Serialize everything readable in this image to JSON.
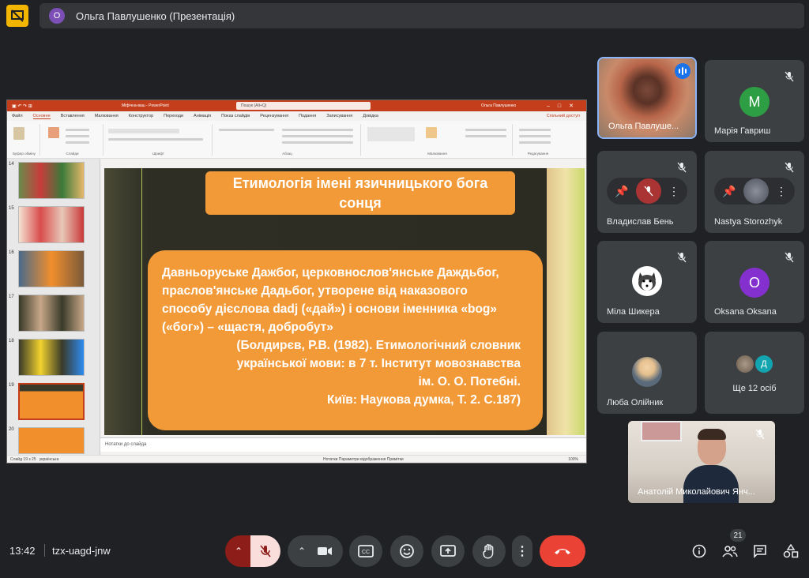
{
  "presenter": {
    "initial": "О",
    "label": "Ольга Павлушенко (Презентація)"
  },
  "powerpoint": {
    "document_title": "Міфічна-ваш - PowerPoint",
    "search_placeholder": "Пошук (Alt+Q)",
    "user": "Ольга Павлушенко",
    "window_controls": "–□✕",
    "menu": [
      "Файл",
      "Основне",
      "Вставлення",
      "Малювання",
      "Конструктор",
      "Переходи",
      "Анімація",
      "Показ слайдів",
      "Рецензування",
      "Подання",
      "Записування",
      "Довідка"
    ],
    "active_menu": "Основне",
    "share": "Спільний доступ",
    "ribbon_groups": [
      "Буфер обміну",
      "Слайди",
      "Шрифт",
      "Абзац",
      "Малювання",
      "Редагування"
    ],
    "thumbnail_numbers": [
      "14",
      "15",
      "16",
      "17",
      "18",
      "19",
      "20"
    ],
    "notes_placeholder": "Нотатки до слайда",
    "status_left": "Слайд 19 з 25",
    "status_lang": "українська",
    "status_mid": "Нотатки    Параметри відображення    Примітки",
    "status_zoom": "100%",
    "slide": {
      "title_line1": "Етимологія імені язичницького бога",
      "title_line2": "сонця",
      "body_line1": "Давньоруське Дажбог, церковнослов'янське Даждьбог,",
      "body_line2": "праслов'янське Дадьбог, утворене від наказового",
      "body_line3": "способу  дієслова dadj («дай») і основи іменника «bog»",
      "body_line4": "(«бог») – «щастя, добробут»",
      "cite_line1": "(Болдирєв, Р.В. (1982). Етимологічний словник",
      "cite_line2": "української мови: в 7 т. Інститут мовознавства",
      "cite_line3": "ім. О. О. Потебні.",
      "cite_line4": "Київ: Наукова думка, Т. 2. С.187)"
    }
  },
  "participants": [
    {
      "name": "Ольга Павлуше...",
      "speaking": true
    },
    {
      "name": "Марія Гавриш",
      "initial": "М",
      "color": "#2e9e44"
    },
    {
      "name": "Владислав Бень"
    },
    {
      "name": "Nastya Storozhyk"
    },
    {
      "name": "Міла Шикера"
    },
    {
      "name": "Oksana Oksana",
      "initial": "O",
      "color": "#8430ce"
    },
    {
      "name": "Люба Олійник"
    },
    {
      "label": "Ще 12 осіб",
      "initial": "Д",
      "color": "#12a4af"
    }
  ],
  "self": {
    "name": "Анатолій Миколайович Янч..."
  },
  "bottom_bar": {
    "time": "13:42",
    "meeting_code": "tzx-uagd-jnw",
    "participants_count": "21"
  },
  "colors": {
    "accent": "#8ab4f8",
    "leave": "#ea4335",
    "slide_orange": "#f39a38",
    "ppt_red": "#c43e1c"
  }
}
